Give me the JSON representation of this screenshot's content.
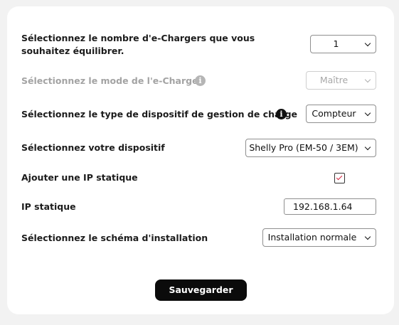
{
  "form": {
    "chargers_count": {
      "label": "Sélectionnez le nombre d'e-Chargers que vous souhaitez équilibrer.",
      "value": "1"
    },
    "charger_mode": {
      "label": "Sélectionnez le mode de l'e-Charger",
      "value": "Maître",
      "disabled": true
    },
    "load_device_type": {
      "label": "Sélectionnez le type de dispositif de gestion de charge",
      "value": "Compteur"
    },
    "device": {
      "label": "Sélectionnez votre dispositif",
      "value": "Shelly Pro (EM-50 / 3EM)"
    },
    "static_ip_toggle": {
      "label": "Ajouter une IP statique",
      "checked": true
    },
    "static_ip": {
      "label": "IP statique",
      "value": "192.168.1.64"
    },
    "installation_scheme": {
      "label": "Sélectionnez le schéma d'installation",
      "value": "Installation normale"
    },
    "save_label": "Sauvegarder"
  },
  "colors": {
    "accent_check": "#d4213d",
    "button_bg": "#0b0b0b",
    "page_bg": "#f2f2f2",
    "card_bg": "#ffffff"
  },
  "icons": {
    "info": "info-icon",
    "chevron": "chevron-down-icon",
    "check": "check-icon"
  }
}
